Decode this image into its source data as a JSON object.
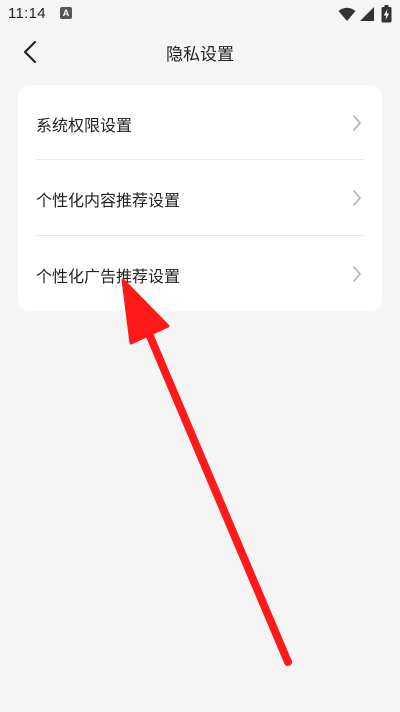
{
  "status_bar": {
    "time": "11:14",
    "app_icon_letter": "A"
  },
  "header": {
    "title": "隐私设置"
  },
  "settings": {
    "items": [
      {
        "label": "系统权限设置"
      },
      {
        "label": "个性化内容推荐设置"
      },
      {
        "label": "个性化广告推荐设置"
      }
    ]
  },
  "colors": {
    "background": "#f5f5f5",
    "card": "#ffffff",
    "divider": "#e6e6e6",
    "annotation_arrow": "#ff1a1a"
  },
  "icons": {
    "back": "chevron-left-icon",
    "row_arrow": "chevron-right-icon",
    "wifi": "wifi-icon",
    "cellular": "signal-icon",
    "battery": "battery-charging-icon",
    "annotation": "red-arrow-icon"
  }
}
